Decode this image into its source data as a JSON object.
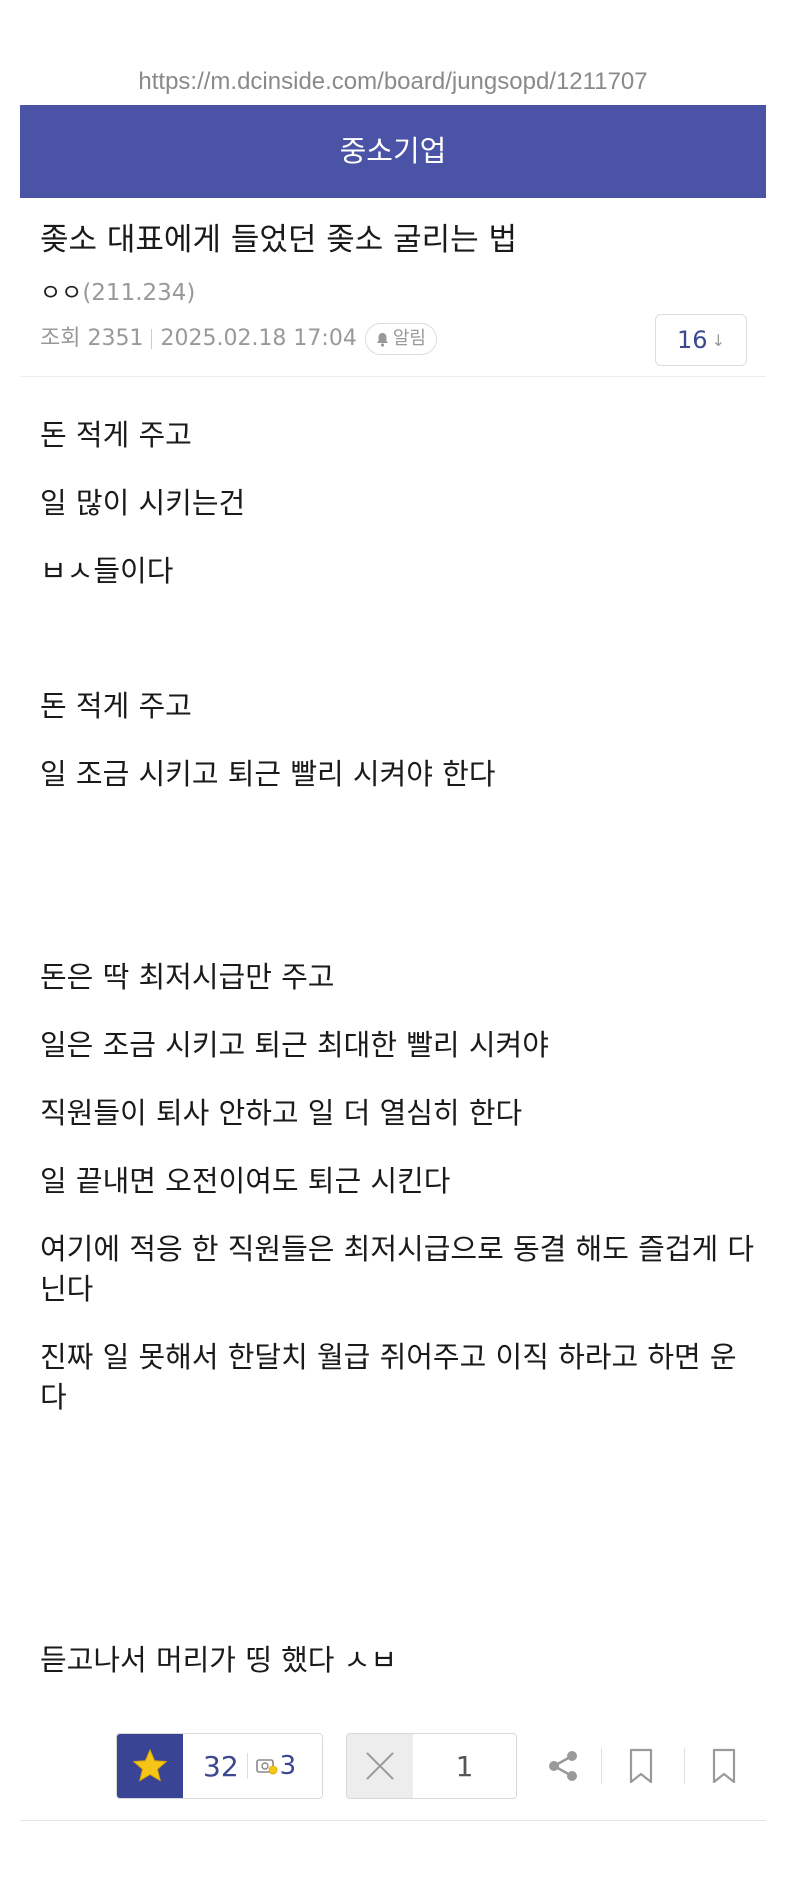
{
  "url": "https://m.dcinside.com/board/jungsopd/1211707",
  "gallery": {
    "name": "중소기업"
  },
  "post": {
    "title": "좆소 대표에게 들었던 좆소 굴리는 법",
    "writer": "ㅇㅇ",
    "writer_ip": "(211.234)",
    "views_label": "조회 2351",
    "datetime": "2025.02.18 17:04",
    "alarm_label": "알림",
    "comment_count": "16",
    "comment_arrow": "↓"
  },
  "body": {
    "lines": [
      "돈 적게 주고",
      "일 많이 시키는건",
      "ㅂㅅ들이다",
      "돈 적게 주고",
      "일 조금 시키고 퇴근 빨리 시켜야 한다",
      "돈은 딱 최저시급만 주고",
      "일은 조금 시키고 퇴근 최대한 빨리 시켜야",
      "직원들이 퇴사 안하고 일 더 열심히 한다",
      "일 끝내면 오전이여도 퇴근 시킨다",
      "여기에 적응 한 직원들은 최저시급으로 동결 해도 즐겁게 다닌다",
      "진짜 일 못해서 한달치 월급 쥐어주고 이직 하라고 하면 운다",
      "듣고나서 머리가 띵 했다 ㅅㅂ"
    ]
  },
  "actions": {
    "recommend_count": "32",
    "fix_recommend_count": "3",
    "nonrecommend_count": "1"
  },
  "colors": {
    "header_bg": "#4a53a5",
    "accent": "#3b4890",
    "star": "#f5c518"
  },
  "icons": [
    "bell-icon",
    "star-icon",
    "fix-icon",
    "close-x-icon",
    "share-icon",
    "bookmark-icon",
    "scrap-icon"
  ]
}
